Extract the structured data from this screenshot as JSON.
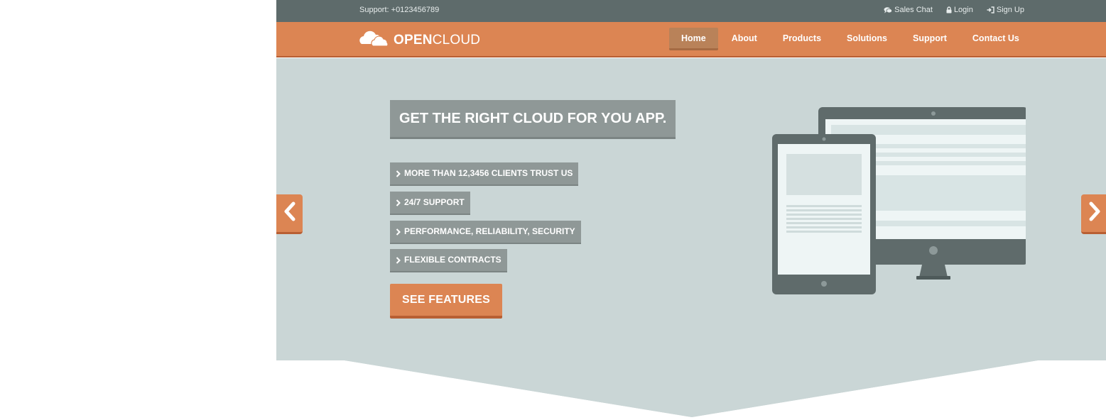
{
  "topbar": {
    "support_text": "Support: +0123456789",
    "links": [
      {
        "label": "Sales Chat",
        "icon": "chat-icon"
      },
      {
        "label": "Login",
        "icon": "lock-icon"
      },
      {
        "label": "Sign Up",
        "icon": "sign-in-icon"
      }
    ]
  },
  "navbar": {
    "logo": {
      "bold": "OPEN",
      "light": "CLOUD",
      "icon": "cloud-icon"
    },
    "menu": [
      {
        "label": "Home",
        "active": true
      },
      {
        "label": "About",
        "active": false
      },
      {
        "label": "Products",
        "active": false
      },
      {
        "label": "Solutions",
        "active": false
      },
      {
        "label": "Support",
        "active": false
      },
      {
        "label": "Contact Us",
        "active": false
      }
    ]
  },
  "hero": {
    "headline": "GET THE RIGHT CLOUD FOR YOU APP.",
    "features": [
      "MORE THAN 12,3456 CLIENTS TRUST US",
      "24/7 SUPPORT",
      "PERFORMANCE, RELIABILITY, SECURITY",
      "FLEXIBLE CONTRACTS"
    ],
    "cta_label": "SEE FEATURES",
    "prev_icon": "chevron-left-icon",
    "next_icon": "chevron-right-icon",
    "illustration_icon": "devices-illustration-icon"
  },
  "colors": {
    "topbar": "#5e6b6b",
    "accent": "#dc8553",
    "hero_bg": "#cad6d6",
    "label_bg": "#8f9897",
    "active_nav": "#b98259"
  }
}
